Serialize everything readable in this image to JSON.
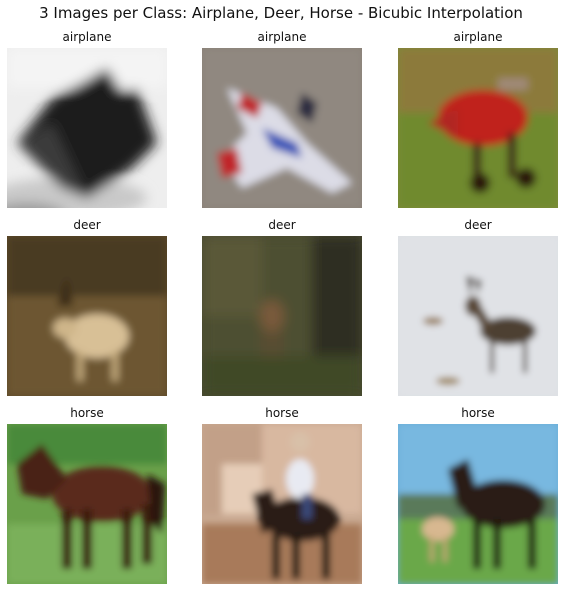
{
  "figure": {
    "title": "3 Images per Class: Airplane, Deer, Horse - Bicubic Interpolation"
  },
  "grid": [
    {
      "label": "airplane",
      "scene": "dark-jet-on-white"
    },
    {
      "label": "airplane",
      "scene": "white-red-jet-on-grey"
    },
    {
      "label": "airplane",
      "scene": "red-biplane-on-grass"
    },
    {
      "label": "deer",
      "scene": "deer-in-brown-brush"
    },
    {
      "label": "deer",
      "scene": "deer-in-dark-forest"
    },
    {
      "label": "deer",
      "scene": "deer-on-snow"
    },
    {
      "label": "horse",
      "scene": "brown-horse-on-grass"
    },
    {
      "label": "horse",
      "scene": "rider-on-dark-horse"
    },
    {
      "label": "horse",
      "scene": "dark-horse-with-foal"
    }
  ]
}
